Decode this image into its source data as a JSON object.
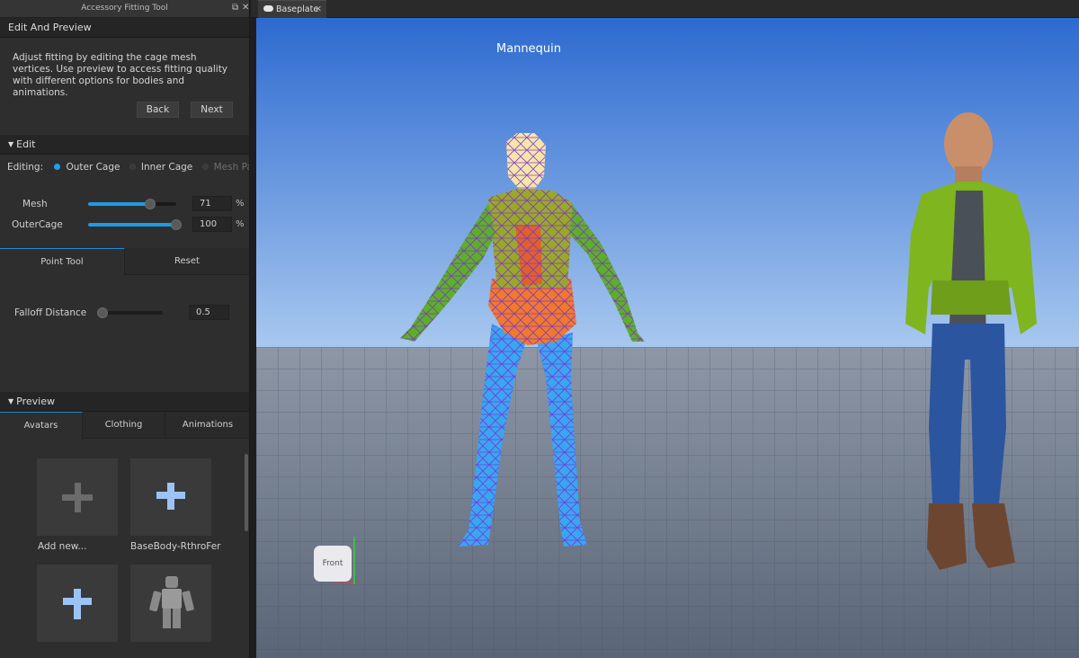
{
  "panel": {
    "title": "Accessory Fitting Tool",
    "step_title": "Edit And Preview",
    "description": "Adjust fitting by editing the cage mesh vertices. Use preview to access fitting quality with different options for bodies and animations.",
    "back_label": "Back",
    "next_label": "Next",
    "edit_section": "Edit",
    "editing_label": "Editing:",
    "editing_options": [
      "Outer Cage",
      "Inner Cage",
      "Mesh Part"
    ],
    "editing_selected": "Outer Cage",
    "mesh_label": "Mesh",
    "mesh_value": "71",
    "mesh_level": 0.71,
    "outercage_label": "OuterCage",
    "outercage_value": "100",
    "outercage_level": 1.0,
    "percent": "%",
    "tool_tabs": [
      "Point Tool",
      "Reset"
    ],
    "falloff_label": "Falloff Distance",
    "falloff_value": "0.5",
    "preview_section": "Preview",
    "preview_tabs": [
      "Avatars",
      "Clothing",
      "Animations"
    ],
    "avatar_tiles": [
      "Add new...",
      "BaseBody-RthroFer"
    ]
  },
  "doc_tab": "Baseplate",
  "viewport": {
    "label": "Mannequin",
    "view_cube": "Front"
  },
  "colors": {
    "accent": "#1e9ae6",
    "sky_top": "#2f6fd1",
    "sky_bottom": "#9fc4f0",
    "jacket": "#7cb61e",
    "jeans": "#2a4f9a"
  }
}
